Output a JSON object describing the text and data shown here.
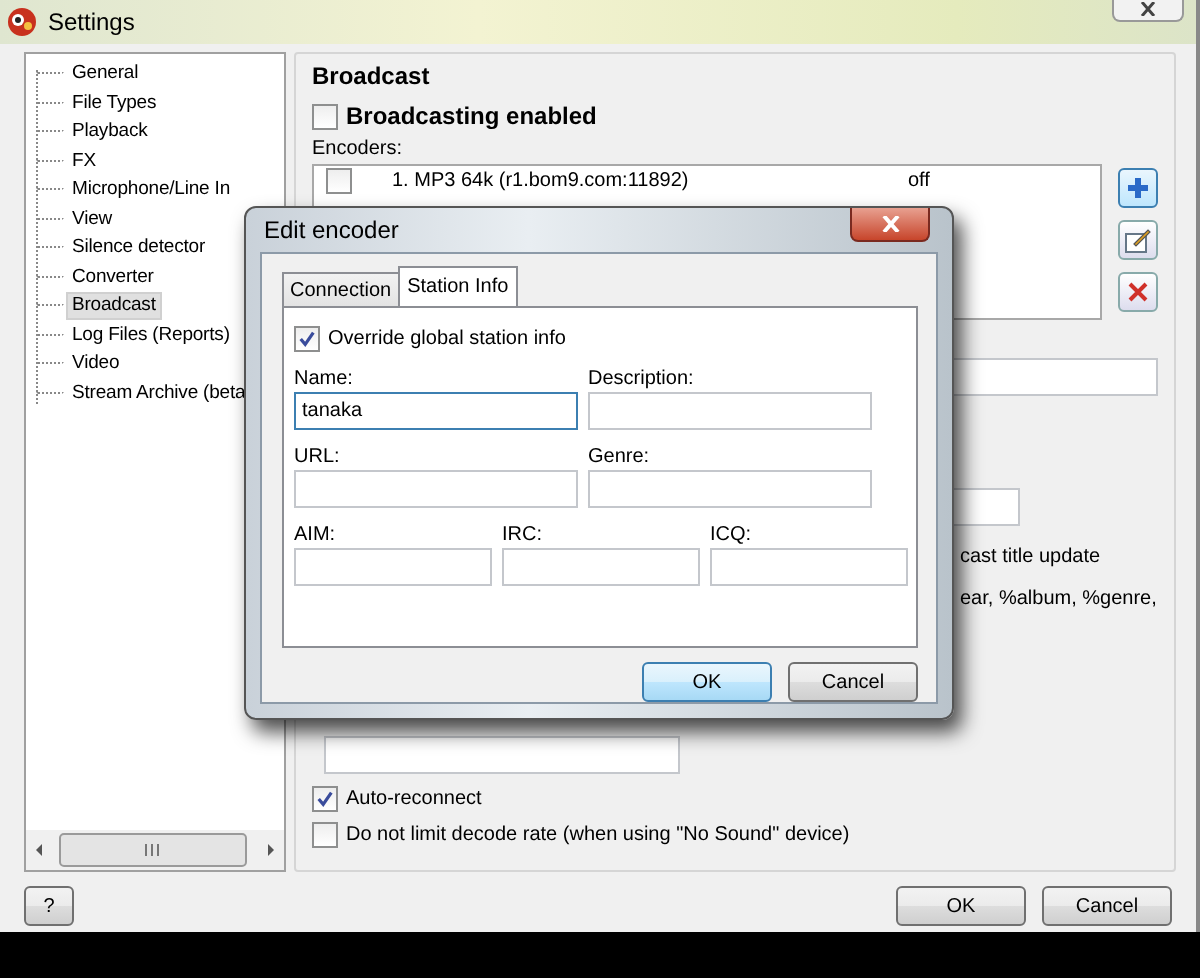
{
  "window": {
    "title": "Settings"
  },
  "sidebar": {
    "items": [
      {
        "label": "General",
        "selected": false
      },
      {
        "label": "File Types",
        "selected": false
      },
      {
        "label": "Playback",
        "selected": false
      },
      {
        "label": "FX",
        "selected": false
      },
      {
        "label": "Microphone/Line In",
        "selected": false
      },
      {
        "label": "View",
        "selected": false
      },
      {
        "label": "Silence detector",
        "selected": false
      },
      {
        "label": "Converter",
        "selected": false
      },
      {
        "label": "Broadcast",
        "selected": true
      },
      {
        "label": "Log Files (Reports)",
        "selected": false
      },
      {
        "label": "Video",
        "selected": false
      },
      {
        "label": "Stream Archive (beta",
        "selected": false
      }
    ]
  },
  "broadcast": {
    "heading": "Broadcast",
    "enabled": {
      "label": "Broadcasting enabled",
      "checked": false
    },
    "encoders_label": "Encoders:",
    "encoders": [
      {
        "name": "1. MP3 64k (r1.bom9.com:11892)",
        "status": "off",
        "checked": false
      }
    ],
    "partial_texts": [
      "cast title update",
      "ear, %album, %genre,"
    ],
    "options": [
      {
        "label": "Auto-reconnect",
        "checked": true
      },
      {
        "label": "Do not limit decode rate (when using \"No Sound\" device)",
        "checked": false
      }
    ]
  },
  "dialog": {
    "title": "Edit encoder",
    "tabs": [
      {
        "label": "Connection",
        "selected": false
      },
      {
        "label": "Station Info",
        "selected": true
      }
    ],
    "override": {
      "label": "Override global station info",
      "checked": true
    },
    "field_rows": [
      [
        {
          "label": "Name:",
          "value": "tanaka",
          "focused": true
        },
        {
          "label": "Description:",
          "focused": false
        }
      ],
      [
        {
          "label": "URL:",
          "focused": false
        },
        {
          "label": "Genre:",
          "focused": false
        }
      ],
      [
        {
          "label": "AIM:",
          "focused": false
        },
        {
          "label": "IRC:",
          "focused": false
        },
        {
          "label": "ICQ:",
          "focused": false
        }
      ]
    ],
    "buttons": [
      {
        "label": "OK",
        "default": true
      },
      {
        "label": "Cancel",
        "default": false
      }
    ]
  },
  "buttons": [
    "?",
    "OK",
    "Cancel"
  ]
}
